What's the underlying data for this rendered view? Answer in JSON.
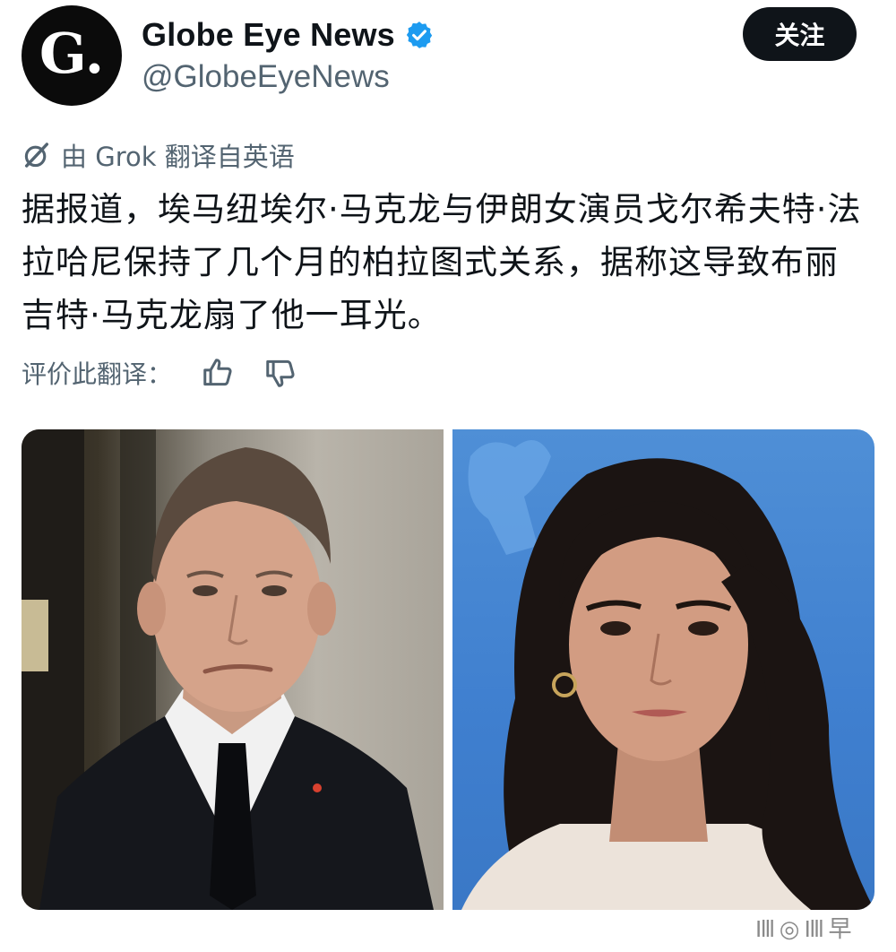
{
  "account": {
    "avatar_letter": "G.",
    "display_name": "Globe Eye News",
    "handle": "@GlobeEyeNews",
    "verified": true,
    "verified_color": "#1d9bf0"
  },
  "follow_button": {
    "label": "关注"
  },
  "translation": {
    "notice": "由 Grok 翻译自英语",
    "rate_label": "评价此翻译："
  },
  "tweet": {
    "text": "据报道，埃马纽埃尔·马克龙与伊朗女演员戈尔希夫特·法拉哈尼保持了几个月的柏拉图式关系，据称这导致布丽吉特·马克龙扇了他一耳光。"
  },
  "media": {
    "images": [
      {
        "name": "photo-man-in-suit"
      },
      {
        "name": "photo-woman-blue-backdrop"
      }
    ]
  },
  "watermark": {
    "text": "Illl ◎ Illl 早"
  }
}
